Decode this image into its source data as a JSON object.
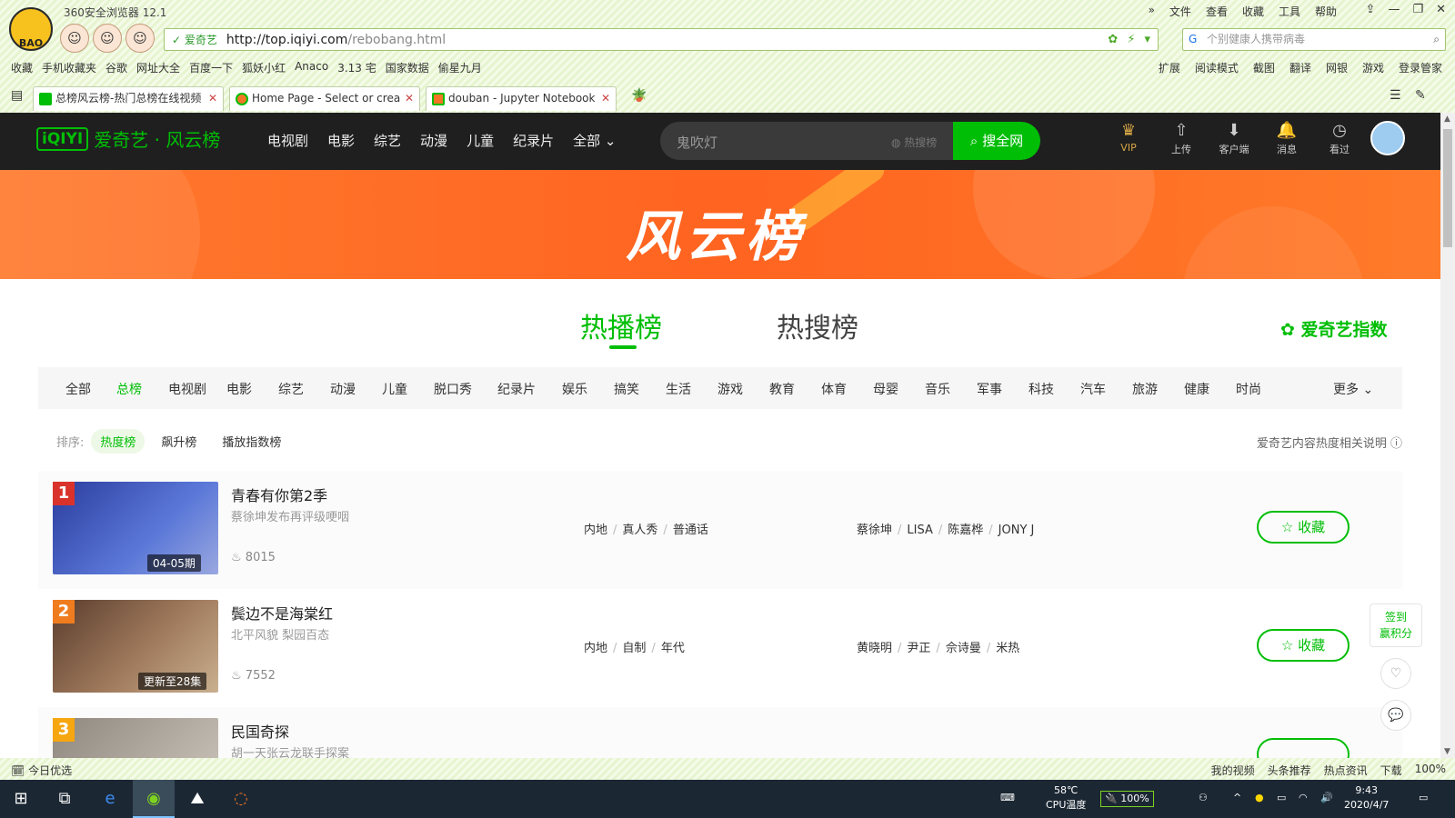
{
  "browser": {
    "title": "360安全浏览器 12.1",
    "menus": [
      "文件",
      "查看",
      "收藏",
      "工具",
      "帮助"
    ],
    "window_controls": [
      "»",
      "⇪",
      "—",
      "❐",
      "✕"
    ],
    "cert_label": "爱奇艺",
    "url_main": "http://top.iqiyi.com",
    "url_path": "/rebobang.html",
    "search_placeholder": "个别健康人携带病毒",
    "bookmarks": [
      "收藏",
      "手机收藏夹",
      "谷歌",
      "网址大全",
      "百度一下",
      "狐妖小红",
      "Anaco",
      "3.13 宅",
      "国家数据",
      "偷星九月"
    ],
    "bookmarks_right": [
      "扩展",
      "阅读模式",
      "截图",
      "翻译",
      "网银",
      "游戏",
      "登录管家"
    ],
    "tabs": [
      {
        "label": "总榜风云榜-热门总榜在线视频",
        "color": "#00be06"
      },
      {
        "label": "Home Page - Select or crea",
        "color": "#f37626"
      },
      {
        "label": "douban - Jupyter Notebook",
        "color": "#f37626"
      }
    ]
  },
  "iqiyi": {
    "logo_box": "iQIYI",
    "logo_text": "爱奇艺 · 风云榜",
    "nav": [
      "电视剧",
      "电影",
      "综艺",
      "动漫",
      "儿童",
      "纪录片",
      "全部 ⌄"
    ],
    "search_placeholder": "鬼吹灯",
    "hot_search": "热搜榜",
    "search_button": "搜全网",
    "header_icons": [
      {
        "name": "vip-icon",
        "glyph": "♛",
        "label": "VIP"
      },
      {
        "name": "upload-icon",
        "glyph": "⇧",
        "label": "上传"
      },
      {
        "name": "client-icon",
        "glyph": "⬇",
        "label": "客户端"
      },
      {
        "name": "bell-icon",
        "glyph": "🔔",
        "label": "消息"
      },
      {
        "name": "history-icon",
        "glyph": "◷",
        "label": "看过"
      }
    ]
  },
  "banner": {
    "title": "风云榜"
  },
  "main_tabs": {
    "active": "热播榜",
    "other": "热搜榜",
    "index_link": "爱奇艺指数"
  },
  "categories": [
    "全部",
    "总榜",
    "电视剧",
    "电影",
    "综艺",
    "动漫",
    "儿童",
    "脱口秀",
    "纪录片",
    "娱乐",
    "搞笑",
    "生活",
    "游戏",
    "教育",
    "体育",
    "母婴",
    "音乐",
    "军事",
    "科技",
    "汽车",
    "旅游",
    "健康",
    "时尚"
  ],
  "active_category": "总榜",
  "more_label": "更多 ⌄",
  "sort": {
    "label": "排序:",
    "options": [
      "热度榜",
      "飙升榜",
      "播放指数榜"
    ],
    "active": "热度榜"
  },
  "explain": "爱奇艺内容热度相关说明 ⓘ",
  "rows": [
    {
      "rank": "1",
      "title": "青春有你第2季",
      "subtitle": "蔡徐坤发布再评级哽咽",
      "heat": "8015",
      "badge": "04-05期",
      "tags": [
        "内地",
        "真人秀",
        "普通话"
      ],
      "cast": [
        "蔡徐坤",
        "LISA",
        "陈嘉桦",
        "JONY J"
      ],
      "thumb_color": "#3c4fb0",
      "fav": "☆ 收藏"
    },
    {
      "rank": "2",
      "title": "鬓边不是海棠红",
      "subtitle": "北平风貌 梨园百态",
      "heat": "7552",
      "badge": "更新至28集",
      "tags": [
        "内地",
        "自制",
        "年代"
      ],
      "cast": [
        "黄晓明",
        "尹正",
        "佘诗曼",
        "米热"
      ],
      "thumb_color": "#7a5a46",
      "fav": "☆ 收藏"
    },
    {
      "rank": "3",
      "title": "民国奇探",
      "subtitle": "胡一天张云龙联手探案",
      "heat": "",
      "badge": "",
      "tags": [],
      "cast": [],
      "thumb_color": "#a9a39a",
      "fav": ""
    }
  ],
  "float": {
    "signin": "签到\n赢积分"
  },
  "statusbar": {
    "left": "今日优选",
    "right": [
      "我的视频",
      "头条推荐",
      "热点资讯",
      "下载",
      "100%"
    ]
  },
  "taskbar": {
    "temp": "58℃",
    "temp_label": "CPU温度",
    "battery": "100%",
    "time": "9:43",
    "date": "2020/4/7"
  }
}
